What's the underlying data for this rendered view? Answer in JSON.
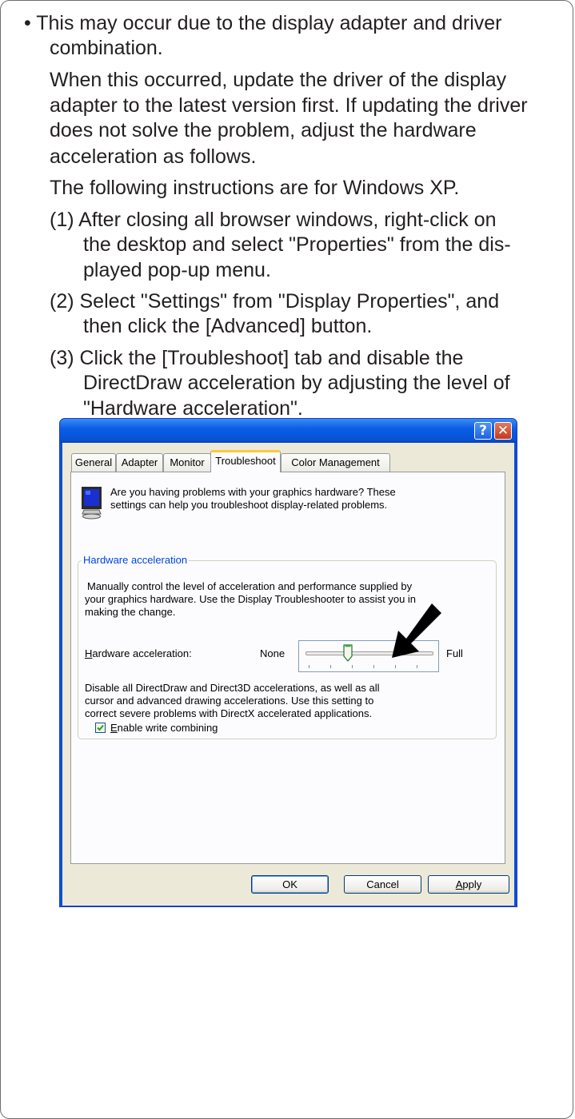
{
  "document": {
    "lines": [
      "• This may occur due to the display adapter and driver",
      "combination.",
      "When this occurred, update the driver of the display",
      "adapter to the latest version first. If updating the driver",
      "does not solve the problem, adjust the hardware",
      "acceleration as follows.",
      "The following instructions are for Windows XP.",
      "(1) After closing all browser windows, right-click on",
      "the desktop and select \"Properties\" from the dis-",
      "played pop-up menu.",
      "(2) Select \"Settings\" from \"Display Properties\", and",
      "then click the [Advanced] button.",
      "(3) Click the [Troubleshoot] tab and disable the",
      "DirectDraw acceleration by adjusting the level of",
      "\"Hardware acceleration\"."
    ]
  },
  "dialog": {
    "title_buttons": {
      "help": "?",
      "close": "✕"
    },
    "tabs": [
      "General",
      "Adapter",
      "Monitor",
      "Troubleshoot",
      "Color Management"
    ],
    "active_tab": "Troubleshoot",
    "intro": [
      "Are you having problems with your graphics hardware? These",
      "settings can help you troubleshoot display-related problems."
    ],
    "group_title": "Hardware acceleration",
    "group_desc": [
      "Manually control the level of acceleration and performance supplied by",
      "your graphics hardware. Use the Display Troubleshooter to assist you in",
      "making the change."
    ],
    "slider": {
      "label_first": "H",
      "label_rest": "ardware acceleration:",
      "min_label": "None",
      "max_label": "Full",
      "level": 0.33
    },
    "level_desc": [
      "Disable all DirectDraw and Direct3D accelerations, as well as all",
      "cursor and advanced drawing accelerations. Use this setting to",
      "correct severe problems with DirectX accelerated applications."
    ],
    "checkbox": {
      "first": "E",
      "rest": "nable write combining",
      "checked": true
    },
    "buttons": {
      "ok": "OK",
      "cancel": "Cancel",
      "apply_first": "A",
      "apply_rest": "pply"
    }
  }
}
